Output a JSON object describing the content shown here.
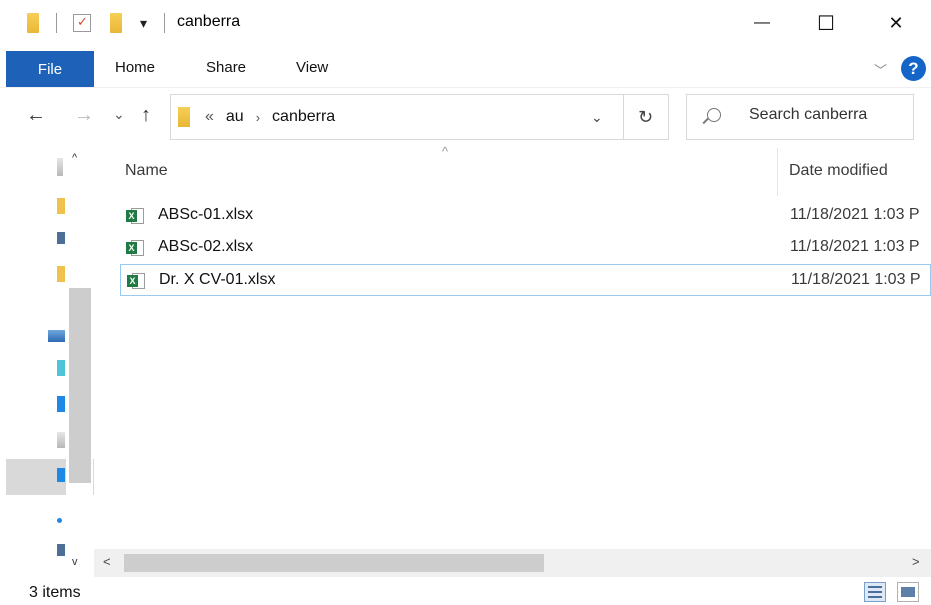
{
  "window": {
    "title": "canberra",
    "minimize_glyph": "—",
    "maximize_glyph": "☐",
    "close_glyph": "✕"
  },
  "quick_access": {
    "dropdown_glyph": "▾",
    "check_glyph": "✓"
  },
  "ribbon": {
    "file_label": "File",
    "tabs": [
      "Home",
      "Share",
      "View"
    ],
    "expand_glyph": "﹀",
    "help_glyph": "?"
  },
  "navigation": {
    "back_glyph": "←",
    "forward_glyph": "→",
    "recent_glyph": "⌄",
    "up_glyph": "↑",
    "overflow_glyph": "«",
    "breadcrumbs": [
      "au",
      "canberra"
    ],
    "crumb_separator": "›",
    "address_dropdown_glyph": "⌄",
    "refresh_glyph": "↻",
    "search_placeholder": "Search canberra"
  },
  "columns": {
    "name": "Name",
    "date_modified": "Date modified",
    "sort_glyph": "^"
  },
  "files": [
    {
      "name": "ABSc-01.xlsx",
      "date": "11/18/2021 1:03 P",
      "icon": "excel-file-icon",
      "badge": "X"
    },
    {
      "name": "ABSc-02.xlsx",
      "date": "11/18/2021 1:03 P",
      "icon": "excel-file-icon",
      "badge": "X"
    },
    {
      "name": "Dr. X CV-01.xlsx",
      "date": "11/18/2021 1:03 P",
      "icon": "excel-file-icon",
      "badge": "X"
    }
  ],
  "scrollbar": {
    "left_glyph": "<",
    "right_glyph": ">",
    "up_glyph": "^",
    "down_glyph": "v"
  },
  "status": {
    "item_count": "3 items"
  },
  "colors": {
    "file_tab": "#1d62b8",
    "help": "#1565c8",
    "excel": "#1f7a44",
    "folder": "#f0c24b",
    "focus_border": "#99c9ef"
  }
}
